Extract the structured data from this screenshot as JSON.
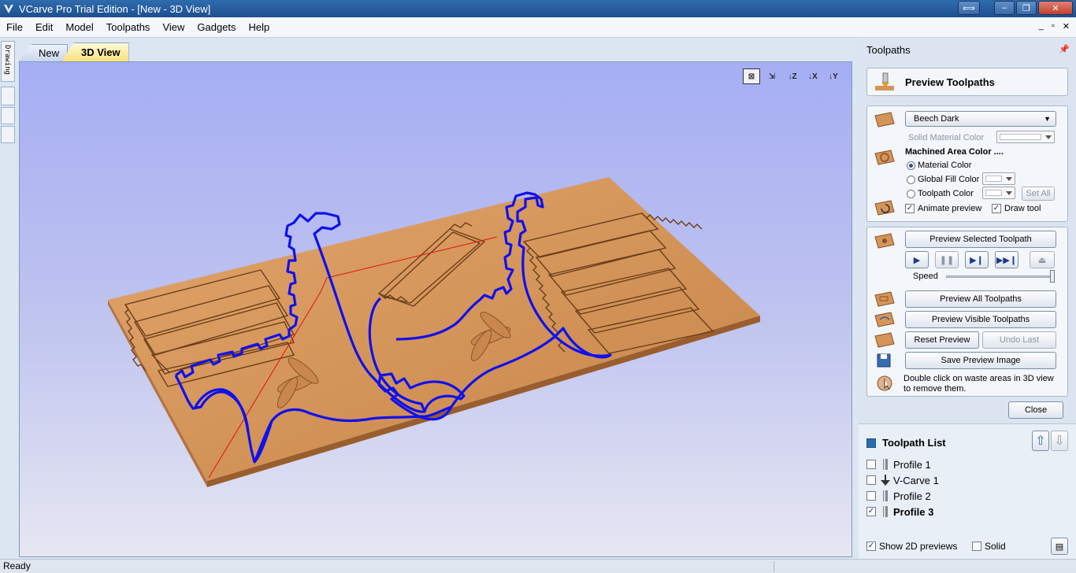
{
  "window": {
    "title": "VCarve Pro Trial Edition - [New - 3D View]"
  },
  "menu": [
    "File",
    "Edit",
    "Model",
    "Toolpaths",
    "View",
    "Gadgets",
    "Help"
  ],
  "left_strip": {
    "drawing_tab": "Drawing"
  },
  "doc_tabs": [
    {
      "label": "New",
      "active": false
    },
    {
      "label": "3D View",
      "active": true
    }
  ],
  "view_toolbar": [
    "fit-view-icon",
    "iso-view-icon",
    "z-view-icon",
    "x-view-icon",
    "y-view-icon"
  ],
  "panel": {
    "header": "Toolpaths",
    "preview_title": "Preview Toolpaths",
    "material": {
      "selected": "Beech Dark",
      "solid_color_label": "Solid Material Color",
      "machined_area_heading": "Machined Area Color ....",
      "options": [
        "Material Color",
        "Global Fill Color",
        "Toolpath Color"
      ],
      "selected_option": "Material Color",
      "set_all": "Set All",
      "animate_preview": "Animate preview",
      "animate_checked": true,
      "draw_tool": "Draw tool",
      "draw_tool_checked": true
    },
    "preview": {
      "preview_selected": "Preview Selected Toolpath",
      "speed_label": "Speed",
      "speed_value": 1.0,
      "preview_all": "Preview All Toolpaths",
      "preview_visible": "Preview Visible Toolpaths",
      "reset_preview": "Reset Preview",
      "undo_last": "Undo Last",
      "save_image": "Save Preview Image",
      "hint": "Double click on waste areas in 3D view to remove them."
    },
    "close": "Close",
    "toolpath_list": {
      "title": "Toolpath List",
      "items": [
        {
          "name": "Profile 1",
          "checked": false,
          "type": "profile"
        },
        {
          "name": "V-Carve 1",
          "checked": false,
          "type": "vcarve"
        },
        {
          "name": "Profile 2",
          "checked": false,
          "type": "profile"
        },
        {
          "name": "Profile 3",
          "checked": true,
          "type": "profile"
        }
      ],
      "show_2d_previews": "Show 2D previews",
      "show_2d_checked": true,
      "solid": "Solid",
      "solid_checked": false
    }
  },
  "status": {
    "text": "Ready"
  },
  "colors": {
    "toolpath": "#1010ee",
    "material": "#d4955a",
    "rapid": "#e01010"
  }
}
